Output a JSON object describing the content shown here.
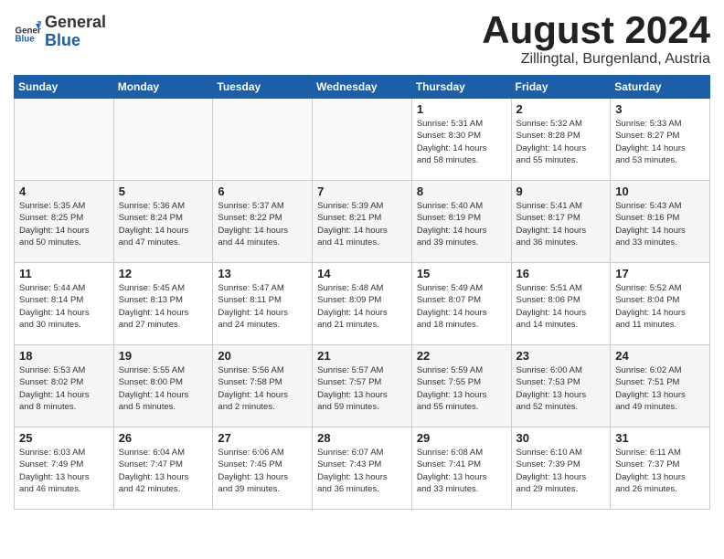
{
  "header": {
    "logo_general": "General",
    "logo_blue": "Blue",
    "month_title": "August 2024",
    "subtitle": "Zillingtal, Burgenland, Austria"
  },
  "weekdays": [
    "Sunday",
    "Monday",
    "Tuesday",
    "Wednesday",
    "Thursday",
    "Friday",
    "Saturday"
  ],
  "weeks": [
    [
      {
        "day": "",
        "info": ""
      },
      {
        "day": "",
        "info": ""
      },
      {
        "day": "",
        "info": ""
      },
      {
        "day": "",
        "info": ""
      },
      {
        "day": "1",
        "info": "Sunrise: 5:31 AM\nSunset: 8:30 PM\nDaylight: 14 hours\nand 58 minutes."
      },
      {
        "day": "2",
        "info": "Sunrise: 5:32 AM\nSunset: 8:28 PM\nDaylight: 14 hours\nand 55 minutes."
      },
      {
        "day": "3",
        "info": "Sunrise: 5:33 AM\nSunset: 8:27 PM\nDaylight: 14 hours\nand 53 minutes."
      }
    ],
    [
      {
        "day": "4",
        "info": "Sunrise: 5:35 AM\nSunset: 8:25 PM\nDaylight: 14 hours\nand 50 minutes."
      },
      {
        "day": "5",
        "info": "Sunrise: 5:36 AM\nSunset: 8:24 PM\nDaylight: 14 hours\nand 47 minutes."
      },
      {
        "day": "6",
        "info": "Sunrise: 5:37 AM\nSunset: 8:22 PM\nDaylight: 14 hours\nand 44 minutes."
      },
      {
        "day": "7",
        "info": "Sunrise: 5:39 AM\nSunset: 8:21 PM\nDaylight: 14 hours\nand 41 minutes."
      },
      {
        "day": "8",
        "info": "Sunrise: 5:40 AM\nSunset: 8:19 PM\nDaylight: 14 hours\nand 39 minutes."
      },
      {
        "day": "9",
        "info": "Sunrise: 5:41 AM\nSunset: 8:17 PM\nDaylight: 14 hours\nand 36 minutes."
      },
      {
        "day": "10",
        "info": "Sunrise: 5:43 AM\nSunset: 8:16 PM\nDaylight: 14 hours\nand 33 minutes."
      }
    ],
    [
      {
        "day": "11",
        "info": "Sunrise: 5:44 AM\nSunset: 8:14 PM\nDaylight: 14 hours\nand 30 minutes."
      },
      {
        "day": "12",
        "info": "Sunrise: 5:45 AM\nSunset: 8:13 PM\nDaylight: 14 hours\nand 27 minutes."
      },
      {
        "day": "13",
        "info": "Sunrise: 5:47 AM\nSunset: 8:11 PM\nDaylight: 14 hours\nand 24 minutes."
      },
      {
        "day": "14",
        "info": "Sunrise: 5:48 AM\nSunset: 8:09 PM\nDaylight: 14 hours\nand 21 minutes."
      },
      {
        "day": "15",
        "info": "Sunrise: 5:49 AM\nSunset: 8:07 PM\nDaylight: 14 hours\nand 18 minutes."
      },
      {
        "day": "16",
        "info": "Sunrise: 5:51 AM\nSunset: 8:06 PM\nDaylight: 14 hours\nand 14 minutes."
      },
      {
        "day": "17",
        "info": "Sunrise: 5:52 AM\nSunset: 8:04 PM\nDaylight: 14 hours\nand 11 minutes."
      }
    ],
    [
      {
        "day": "18",
        "info": "Sunrise: 5:53 AM\nSunset: 8:02 PM\nDaylight: 14 hours\nand 8 minutes."
      },
      {
        "day": "19",
        "info": "Sunrise: 5:55 AM\nSunset: 8:00 PM\nDaylight: 14 hours\nand 5 minutes."
      },
      {
        "day": "20",
        "info": "Sunrise: 5:56 AM\nSunset: 7:58 PM\nDaylight: 14 hours\nand 2 minutes."
      },
      {
        "day": "21",
        "info": "Sunrise: 5:57 AM\nSunset: 7:57 PM\nDaylight: 13 hours\nand 59 minutes."
      },
      {
        "day": "22",
        "info": "Sunrise: 5:59 AM\nSunset: 7:55 PM\nDaylight: 13 hours\nand 55 minutes."
      },
      {
        "day": "23",
        "info": "Sunrise: 6:00 AM\nSunset: 7:53 PM\nDaylight: 13 hours\nand 52 minutes."
      },
      {
        "day": "24",
        "info": "Sunrise: 6:02 AM\nSunset: 7:51 PM\nDaylight: 13 hours\nand 49 minutes."
      }
    ],
    [
      {
        "day": "25",
        "info": "Sunrise: 6:03 AM\nSunset: 7:49 PM\nDaylight: 13 hours\nand 46 minutes."
      },
      {
        "day": "26",
        "info": "Sunrise: 6:04 AM\nSunset: 7:47 PM\nDaylight: 13 hours\nand 42 minutes."
      },
      {
        "day": "27",
        "info": "Sunrise: 6:06 AM\nSunset: 7:45 PM\nDaylight: 13 hours\nand 39 minutes."
      },
      {
        "day": "28",
        "info": "Sunrise: 6:07 AM\nSunset: 7:43 PM\nDaylight: 13 hours\nand 36 minutes."
      },
      {
        "day": "29",
        "info": "Sunrise: 6:08 AM\nSunset: 7:41 PM\nDaylight: 13 hours\nand 33 minutes."
      },
      {
        "day": "30",
        "info": "Sunrise: 6:10 AM\nSunset: 7:39 PM\nDaylight: 13 hours\nand 29 minutes."
      },
      {
        "day": "31",
        "info": "Sunrise: 6:11 AM\nSunset: 7:37 PM\nDaylight: 13 hours\nand 26 minutes."
      }
    ]
  ]
}
